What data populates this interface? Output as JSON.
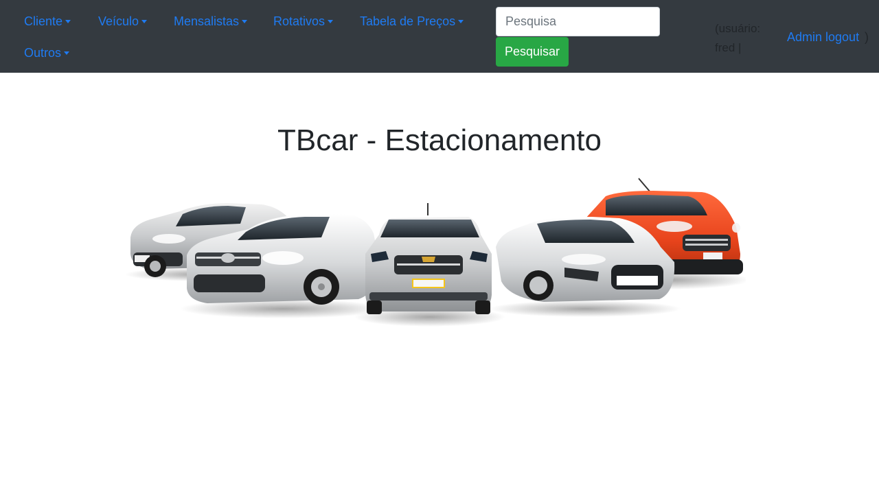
{
  "navbar": {
    "menus": [
      {
        "label": "Cliente"
      },
      {
        "label": "Veículo"
      },
      {
        "label": "Mensalistas"
      },
      {
        "label": "Rotativos"
      },
      {
        "label": "Tabela de Preços"
      },
      {
        "label": "Outros"
      }
    ],
    "search": {
      "placeholder": "Pesquisa",
      "value": "",
      "button_label": "Pesquisar"
    },
    "user": {
      "prefix": "(usuário:",
      "name": "fred |",
      "logout_label": "Admin logout",
      "suffix": ")"
    }
  },
  "main": {
    "title": "TBcar - Estacionamento",
    "image": {
      "icon": "cars-lineup-image"
    }
  },
  "colors": {
    "navbar_bg": "#343a40",
    "link": "#1f7bf2",
    "success": "#28a745",
    "text": "#212529",
    "ford_orange": "#e8441c"
  }
}
